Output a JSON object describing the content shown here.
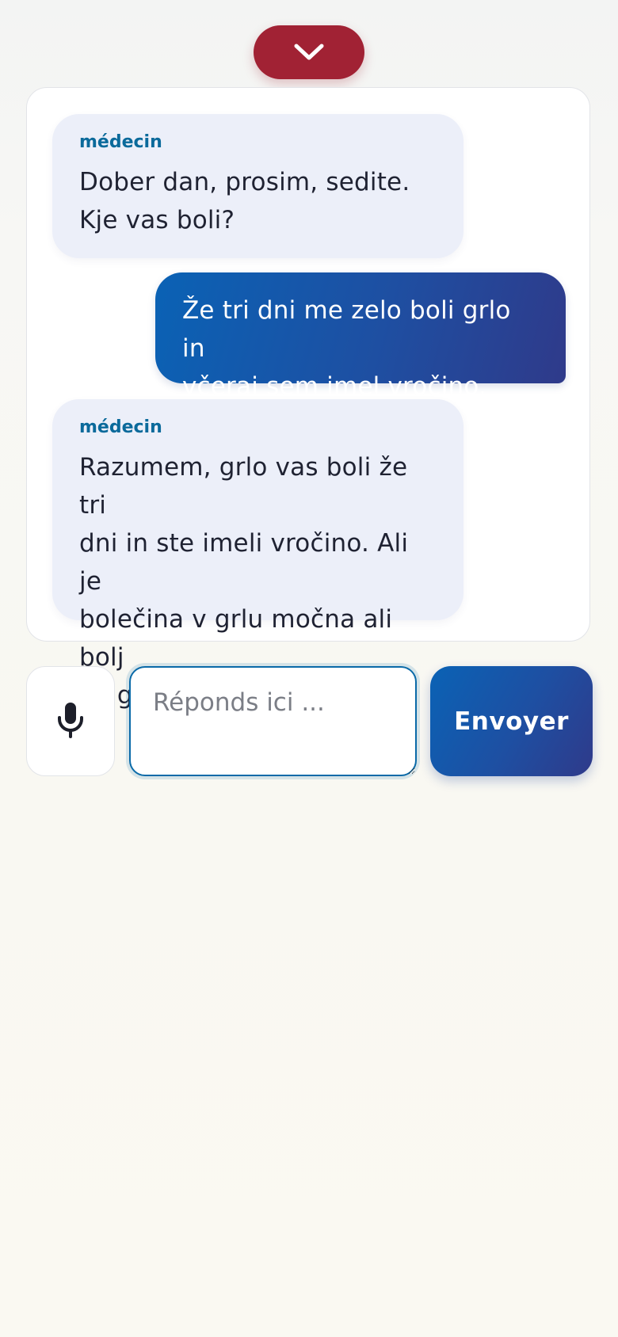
{
  "header": {
    "collapse_icon": "chevron-down-icon"
  },
  "colors": {
    "collapse_button": "#a12234",
    "sender_label": "#0b6a9b",
    "incoming_bubble": "#eceff9",
    "outgoing_bubble_start": "#0a62b5",
    "outgoing_bubble_end": "#2f3a8a"
  },
  "chat": {
    "messages": [
      {
        "role": "incoming",
        "sender": "médecin",
        "lines": [
          "Dober dan, prosim, sedite.",
          "Kje vas boli?"
        ]
      },
      {
        "role": "outgoing",
        "sender": "",
        "lines": [
          "Že tri dni me zelo boli grlo in",
          "včeraj sem imel vročino."
        ]
      },
      {
        "role": "incoming",
        "sender": "médecin",
        "lines": [
          "Razumem, grlo vas boli že tri",
          "dni in ste imeli vročino. Ali je",
          "bolečina v grlu močna ali bolj",
          "blaga?"
        ]
      }
    ]
  },
  "composer": {
    "mic_icon": "microphone-icon",
    "input_value": "",
    "input_placeholder": "Réponds ici ...",
    "send_label": "Envoyer"
  }
}
